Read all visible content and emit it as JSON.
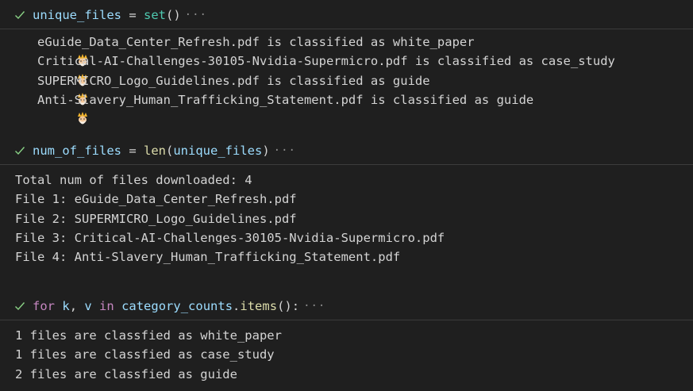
{
  "cells": [
    {
      "code_tokens": [
        {
          "text": "unique_files",
          "kind": "var"
        },
        {
          "text": " = ",
          "kind": "op"
        },
        {
          "text": "set",
          "kind": "type"
        },
        {
          "text": "()",
          "kind": "punct"
        }
      ],
      "collapsed_indicator": "···",
      "output_lines": [
        {
          "icon": "gnome-emoji-icon",
          "text": "eGuide_Data_Center_Refresh.pdf is classified as white_paper"
        },
        {
          "icon": "gnome-emoji-icon",
          "text": "Critical-AI-Challenges-30105-Nvidia-Supermicro.pdf is classified as case_study"
        },
        {
          "icon": "gnome-emoji-icon",
          "text": "SUPERMICRO_Logo_Guidelines.pdf is classified as guide"
        },
        {
          "icon": "gnome-emoji-icon",
          "text": "Anti-Slavery_Human_Trafficking_Statement.pdf is classified as guide"
        }
      ]
    },
    {
      "code_tokens": [
        {
          "text": "num_of_files",
          "kind": "var"
        },
        {
          "text": " = ",
          "kind": "op"
        },
        {
          "text": "len",
          "kind": "fn"
        },
        {
          "text": "(",
          "kind": "punct"
        },
        {
          "text": "unique_files",
          "kind": "var"
        },
        {
          "text": ")",
          "kind": "punct"
        }
      ],
      "collapsed_indicator": "···",
      "output_lines": [
        {
          "text": "Total num of files downloaded: 4"
        },
        {
          "text": "File 1: eGuide_Data_Center_Refresh.pdf"
        },
        {
          "text": "File 2: SUPERMICRO_Logo_Guidelines.pdf"
        },
        {
          "text": "File 3: Critical-AI-Challenges-30105-Nvidia-Supermicro.pdf"
        },
        {
          "text": "File 4: Anti-Slavery_Human_Trafficking_Statement.pdf"
        }
      ]
    },
    {
      "code_tokens": [
        {
          "text": "for",
          "kind": "kw"
        },
        {
          "text": " ",
          "kind": "op"
        },
        {
          "text": "k",
          "kind": "var"
        },
        {
          "text": ", ",
          "kind": "punct"
        },
        {
          "text": "v",
          "kind": "var"
        },
        {
          "text": " ",
          "kind": "op"
        },
        {
          "text": "in",
          "kind": "kw"
        },
        {
          "text": " ",
          "kind": "op"
        },
        {
          "text": "category_counts",
          "kind": "var"
        },
        {
          "text": ".",
          "kind": "punct"
        },
        {
          "text": "items",
          "kind": "fn"
        },
        {
          "text": "():",
          "kind": "punct"
        }
      ],
      "collapsed_indicator": "···",
      "output_lines": [
        {
          "text": "1 files are classfied as white_paper"
        },
        {
          "text": "1 files are classfied as case_study"
        },
        {
          "text": "2 files are classfied as guide"
        }
      ]
    }
  ],
  "colors": {
    "background": "#1f1f1f",
    "check": "#89d185",
    "divider": "#3c3c3c",
    "text": "#d4d4d4"
  }
}
